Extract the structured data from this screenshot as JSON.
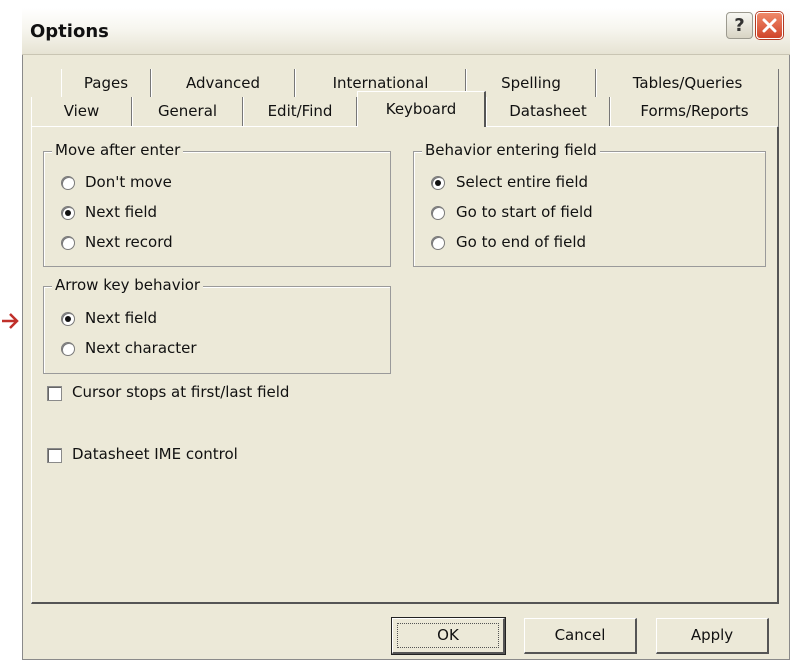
{
  "window": {
    "title": "Options"
  },
  "titlebar": {
    "help_glyph": "?",
    "close_icon": "close-x-icon"
  },
  "tabs": {
    "row1": [
      "Pages",
      "Advanced",
      "International",
      "Spelling",
      "Tables/Queries"
    ],
    "row2": [
      "View",
      "General",
      "Edit/Find",
      "Keyboard",
      "Datasheet",
      "Forms/Reports"
    ],
    "active": "Keyboard"
  },
  "move_after_enter": {
    "label": "Move after enter",
    "options": [
      "Don't move",
      "Next field",
      "Next record"
    ],
    "selected": "Next field"
  },
  "behavior_entering_field": {
    "label": "Behavior entering field",
    "options": [
      "Select entire field",
      "Go to start of field",
      "Go to end of field"
    ],
    "selected": "Select entire field"
  },
  "arrow_key_behavior": {
    "label": "Arrow key behavior",
    "options": [
      "Next field",
      "Next character"
    ],
    "selected": "Next field"
  },
  "checkboxes": {
    "cursor_stops": {
      "label": "Cursor stops at first/last field",
      "checked": false
    },
    "ime_control": {
      "label": "Datasheet IME control",
      "checked": false
    }
  },
  "buttons": {
    "ok": "OK",
    "cancel": "Cancel",
    "apply": "Apply"
  },
  "colors": {
    "dialog_bg": "#ECE9D8",
    "close_button": "#D0442A",
    "annotation_arrow": "#C0302A"
  }
}
